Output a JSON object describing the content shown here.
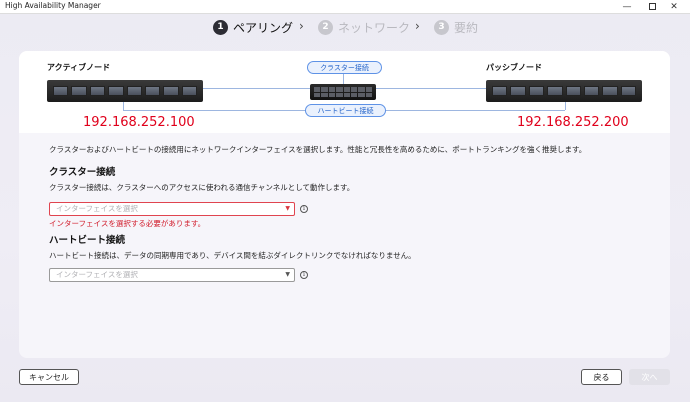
{
  "window": {
    "title": "High Availability Manager",
    "min_label": "—",
    "close_label": "✕"
  },
  "stepper": {
    "steps": [
      {
        "num": "1",
        "label": "ペアリング",
        "state": "active"
      },
      {
        "num": "2",
        "label": "ネットワーク",
        "state": "inactive"
      },
      {
        "num": "3",
        "label": "要約",
        "state": "inactive"
      }
    ],
    "separator": "›"
  },
  "topology": {
    "active_node_label": "アクティブノード",
    "passive_node_label": "パッシブノード",
    "active_ip": "192.168.252.100",
    "passive_ip": "192.168.252.200",
    "cluster_pill": "クラスター接続",
    "heartbeat_pill": "ハートビート接続"
  },
  "intro": "クラスターおよびハートビートの接続用にネットワークインターフェイスを選択します。性能と冗長性を高めるために、ポートトランキングを強く推奨します。",
  "cluster": {
    "heading": "クラスター接続",
    "description": "クラスター接続は、クラスターへのアクセスに使われる通信チャンネルとして動作します。",
    "placeholder": "インターフェイスを選択",
    "error": "インターフェイスを選択する必要があります。",
    "info_glyph": "i"
  },
  "heartbeat": {
    "heading": "ハートビート接続",
    "description": "ハートビート接続は、データの同期専用であり、デバイス間を結ぶダイレクトリンクでなければなりません。",
    "placeholder": "インターフェイスを選択",
    "info_glyph": "i"
  },
  "footer": {
    "cancel": "キャンセル",
    "back": "戻る",
    "next": "次へ"
  },
  "colors": {
    "ip_red": "#e0001b",
    "error_red": "#d11b2a",
    "accent_blue": "#1f60c8"
  }
}
